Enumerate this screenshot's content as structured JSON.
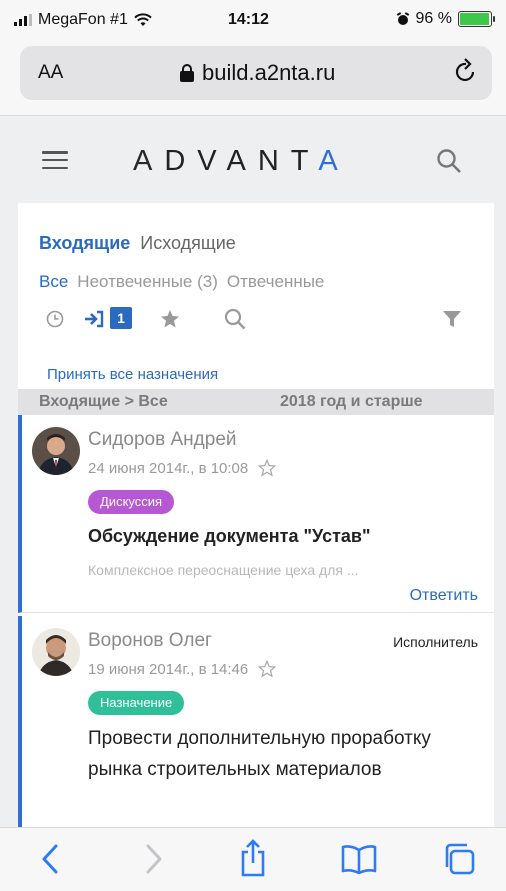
{
  "status_bar": {
    "carrier": "MegaFon #1",
    "time": "14:12",
    "battery_text": "96 %",
    "battery_level": 0.96
  },
  "browser": {
    "text_size_label": "AA",
    "domain": "build.a2nta.ru"
  },
  "header": {
    "logo_text": "ADVANTA"
  },
  "mail": {
    "tabs": [
      "Входящие",
      "Исходящие"
    ],
    "subtabs": [
      "Все",
      "Неотвеченные (3)",
      "Отвеченные"
    ],
    "incoming_count": "1",
    "accept_all_label": "Принять все назначения",
    "breadcrumb": "Входящие > Все",
    "period": "2018 год и старше",
    "items": [
      {
        "author": "Сидоров Андрей",
        "date": "24 июня 2014г., в 10:08",
        "tag": "Дискуссия",
        "title": "Обсуждение документа \"Устав\"",
        "description": "Комплексное переоснащение цеха для ...",
        "reply_label": "Ответить"
      },
      {
        "author": "Воронов Олег",
        "role": "Исполнитель",
        "date": "19 июня 2014г., в 14:46",
        "tag": "Назначение",
        "title": "Провести дополнительную проработку рынка строительных материалов"
      }
    ]
  },
  "colors": {
    "accent_blue": "#2a6bc0",
    "discussion_tag": "#b658d3",
    "assignment_tag": "#2fc09a",
    "logo_red": "#e0262b",
    "item_border": "#2f6fd1"
  }
}
